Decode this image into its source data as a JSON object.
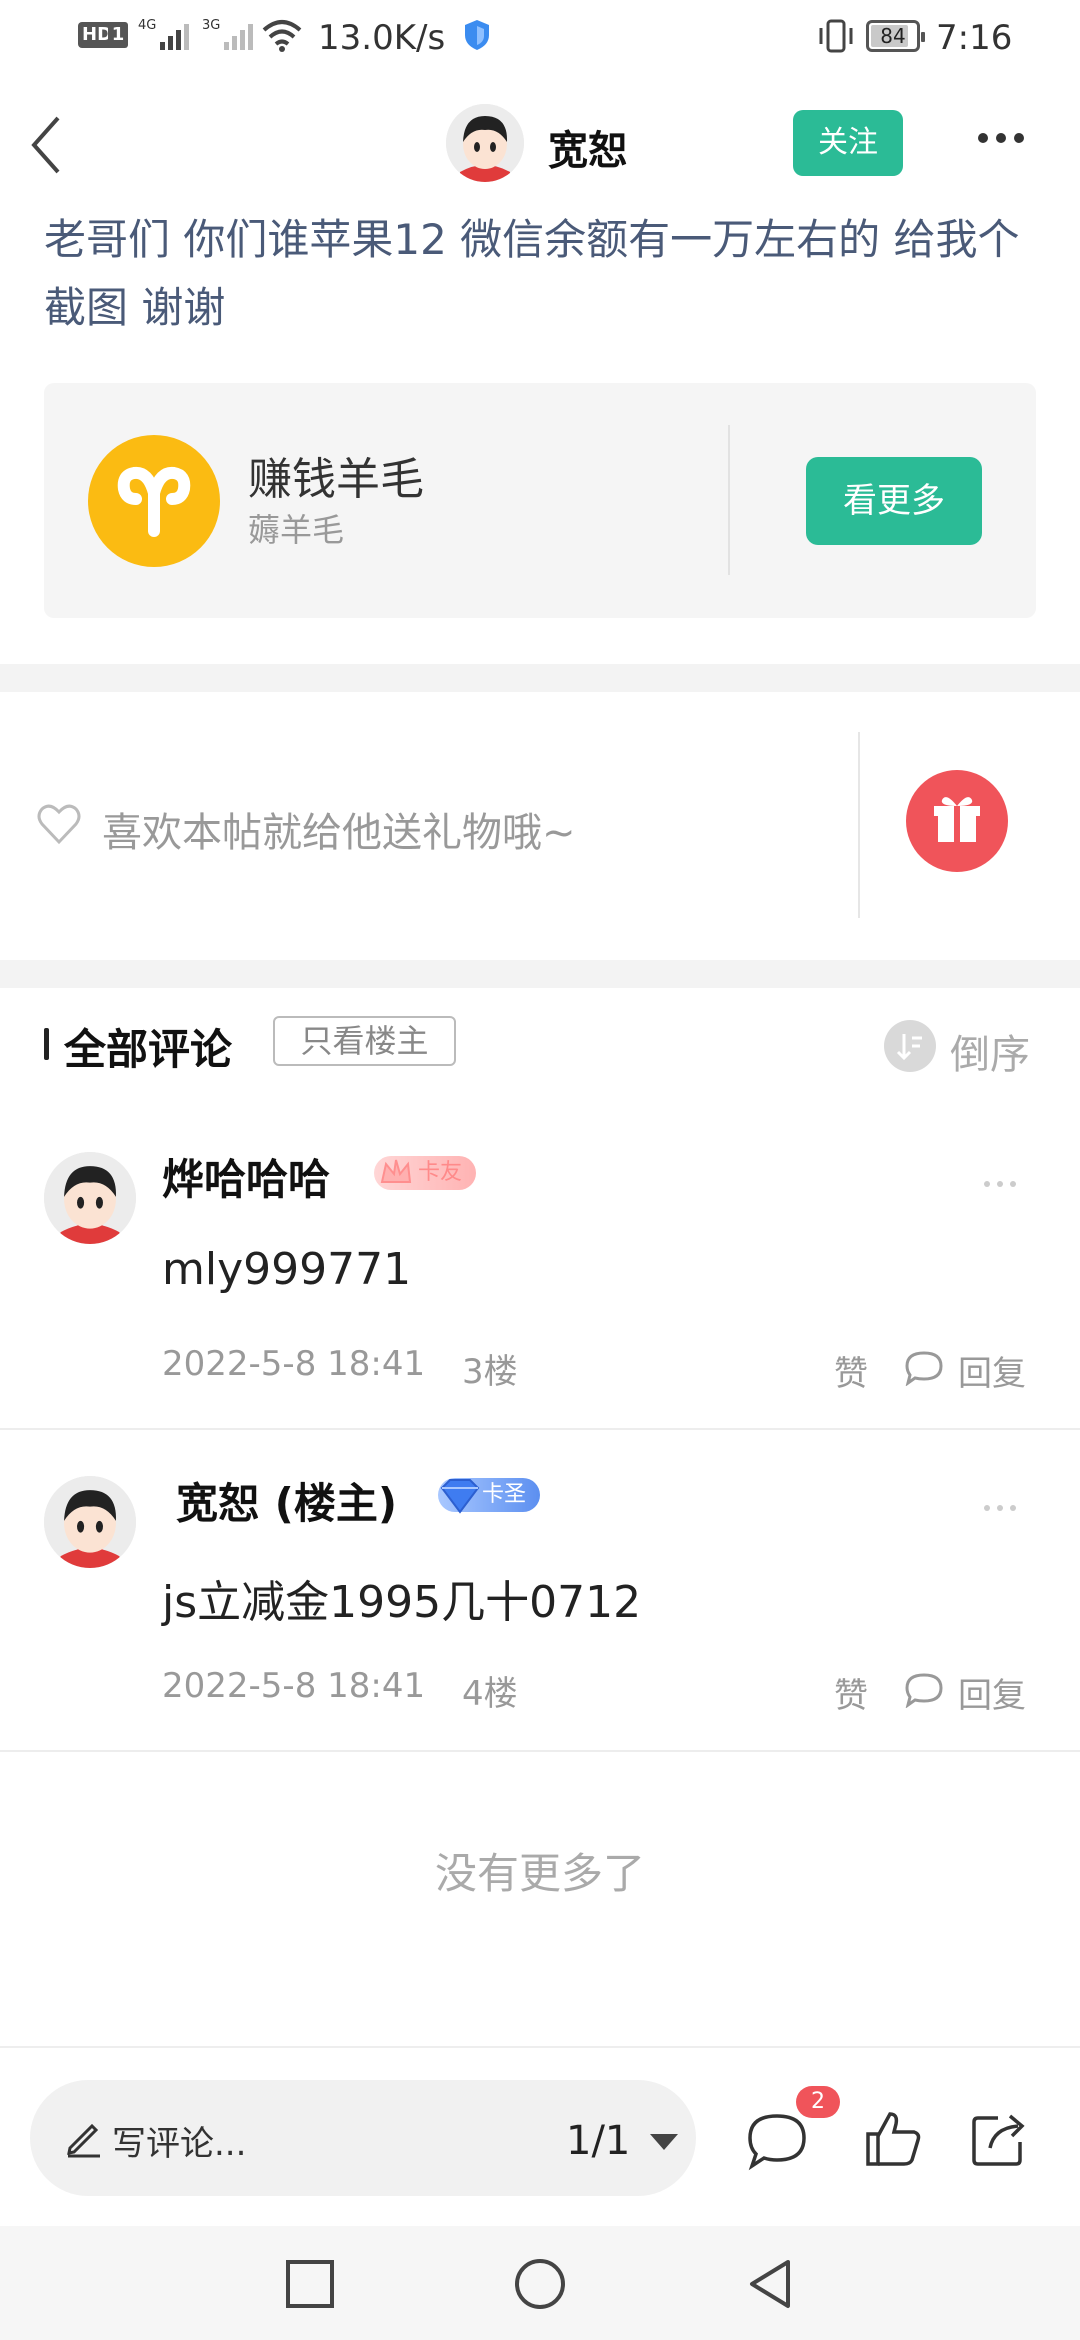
{
  "status_bar": {
    "hd": "HD",
    "sim": "1",
    "net1": "4G",
    "net2": "3G",
    "speed": "13.0K/s",
    "battery": "84",
    "battery_level": 0.84,
    "time": "7:16"
  },
  "header": {
    "username": "宽恕",
    "follow_label": "关注"
  },
  "post": {
    "title": "老哥们 你们谁苹果12 微信余额有一万左右的 给我个截图 谢谢"
  },
  "topic": {
    "name": "赚钱羊毛",
    "subtitle": "薅羊毛",
    "more_label": "看更多",
    "logo_color": "#fbbb12"
  },
  "gift": {
    "text": "喜欢本帖就给他送礼物哦~"
  },
  "comments_header": {
    "title": "全部评论",
    "owner_only": "只看楼主",
    "sort_label": "倒序"
  },
  "comments": [
    {
      "name": "烨哈哈哈",
      "badge": "卡友",
      "body": "mly999771",
      "date": "2022-5-8 18:41",
      "floor": "3楼",
      "like": "赞",
      "reply": "回复"
    },
    {
      "name": "宽恕 (楼主)",
      "badge": "卡圣",
      "body": "js立减金1995几十0712",
      "date": "2022-5-8 18:41",
      "floor": "4楼",
      "like": "赞",
      "reply": "回复"
    }
  ],
  "no_more": "没有更多了",
  "bottom_bar": {
    "compose_placeholder": "写评论...",
    "page_indicator": "1/1",
    "comment_count": "2"
  },
  "colors": {
    "accent": "#2bbb96",
    "gift": "#f0545a",
    "title_text": "#4a5a78"
  }
}
